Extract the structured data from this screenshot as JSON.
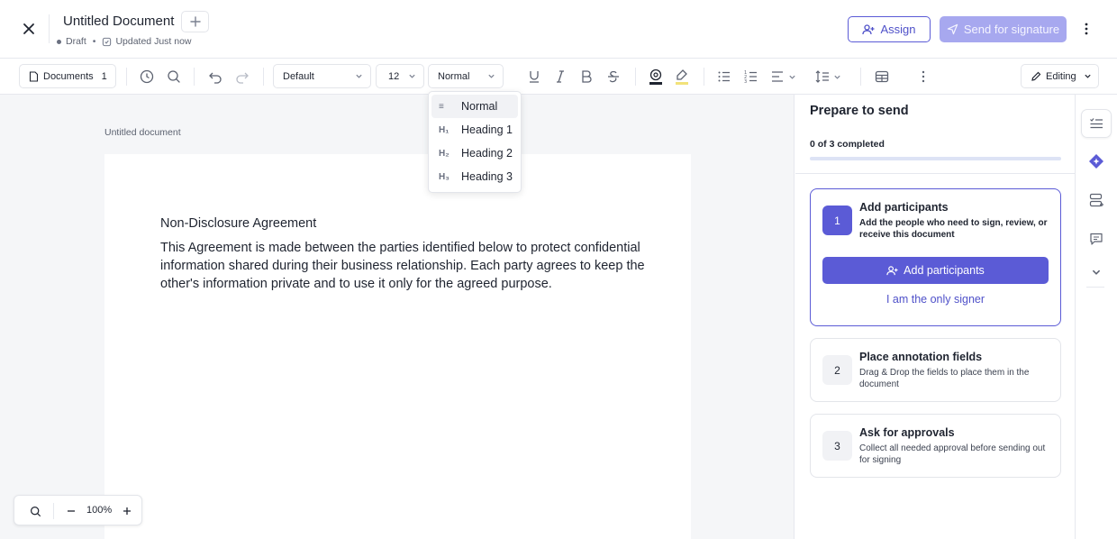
{
  "header": {
    "title": "Untitled Document",
    "status": "Draft",
    "updated": "Updated Just now",
    "assign_label": "Assign",
    "send_label": "Send for signature",
    "brand_color": "#5b5bd6"
  },
  "toolbar": {
    "documents_label": "Documents",
    "documents_count": "1",
    "font_family": "Default",
    "font_size": "12",
    "text_style": "Normal",
    "mode": "Editing"
  },
  "style_menu": {
    "items": [
      {
        "icon": "≡",
        "label": "Normal"
      },
      {
        "icon": "H₁",
        "label": "Heading 1"
      },
      {
        "icon": "H₂",
        "label": "Heading 2"
      },
      {
        "icon": "H₃",
        "label": "Heading 3"
      }
    ]
  },
  "document": {
    "page_label": "Untitled document",
    "heading": "Non-Disclosure Agreement",
    "body": "This Agreement is made between the parties identified below to protect confidential information shared during their business relationship. Each party agrees to keep the other's information private and to use it only for the agreed purpose."
  },
  "zoom": {
    "level": "100%"
  },
  "panel": {
    "title": "Prepare to send",
    "progress_text": "0 of 3 completed",
    "progress_fraction": 0,
    "steps": [
      {
        "number": "1",
        "title": "Add participants",
        "description": "Add the people who need to sign, review, or receive this document",
        "primary_action": "Add participants",
        "secondary_action": "I am the only signer"
      },
      {
        "number": "2",
        "title": "Place annotation fields",
        "description": "Drag & Drop the fields to place them in the document"
      },
      {
        "number": "3",
        "title": "Ask for approvals",
        "description": "Collect all needed approval before sending out for signing"
      }
    ]
  }
}
